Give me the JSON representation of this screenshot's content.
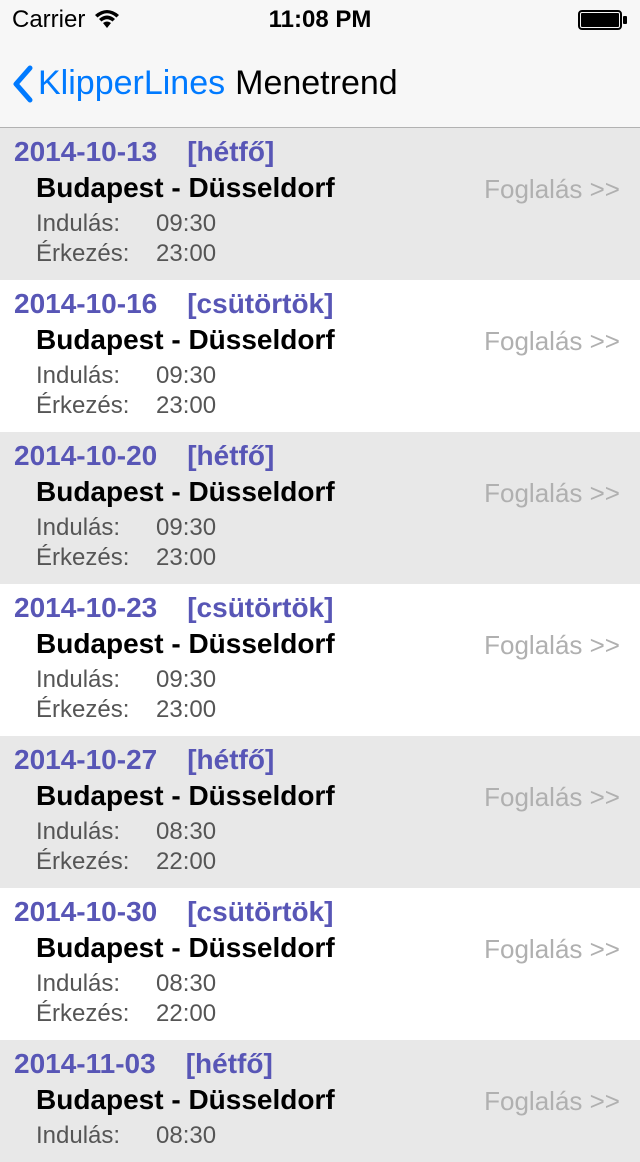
{
  "status": {
    "carrier": "Carrier",
    "time": "11:08 PM"
  },
  "nav": {
    "back_label": "KlipperLines",
    "title": "Menetrend"
  },
  "labels": {
    "departure": "Indulás:",
    "arrival": "Érkezés:",
    "book": "Foglalás >>"
  },
  "schedule": [
    {
      "date": "2014-10-13",
      "day": "[hétfő]",
      "route": "Budapest - Düsseldorf",
      "dep": "09:30",
      "arr": "23:00"
    },
    {
      "date": "2014-10-16",
      "day": "[csütörtök]",
      "route": "Budapest - Düsseldorf",
      "dep": "09:30",
      "arr": "23:00"
    },
    {
      "date": "2014-10-20",
      "day": "[hétfő]",
      "route": "Budapest - Düsseldorf",
      "dep": "09:30",
      "arr": "23:00"
    },
    {
      "date": "2014-10-23",
      "day": "[csütörtök]",
      "route": "Budapest - Düsseldorf",
      "dep": "09:30",
      "arr": "23:00"
    },
    {
      "date": "2014-10-27",
      "day": "[hétfő]",
      "route": "Budapest - Düsseldorf",
      "dep": "08:30",
      "arr": "22:00"
    },
    {
      "date": "2014-10-30",
      "day": "[csütörtök]",
      "route": "Budapest - Düsseldorf",
      "dep": "08:30",
      "arr": "22:00"
    },
    {
      "date": "2014-11-03",
      "day": "[hétfő]",
      "route": "Budapest - Düsseldorf",
      "dep": "08:30",
      "arr": ""
    }
  ]
}
